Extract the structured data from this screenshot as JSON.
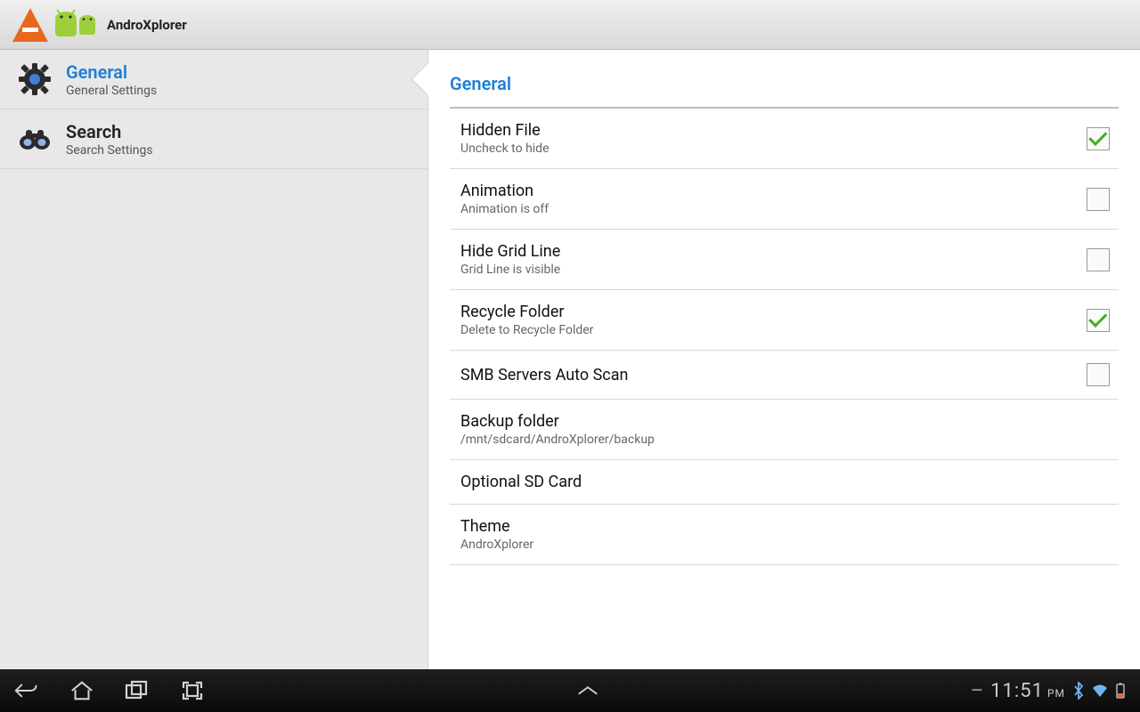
{
  "app": {
    "title": "AndroXplorer"
  },
  "sidebar": {
    "items": [
      {
        "title": "General",
        "subtitle": "General Settings",
        "icon": "gear-icon",
        "active": true
      },
      {
        "title": "Search",
        "subtitle": "Search Settings",
        "icon": "binoculars-icon",
        "active": false
      }
    ]
  },
  "content": {
    "heading": "General",
    "settings": [
      {
        "title": "Hidden File",
        "subtitle": "Uncheck to hide",
        "has_checkbox": true,
        "checked": true
      },
      {
        "title": "Animation",
        "subtitle": "Animation is off",
        "has_checkbox": true,
        "checked": false
      },
      {
        "title": "Hide Grid Line",
        "subtitle": "Grid Line is visible",
        "has_checkbox": true,
        "checked": false
      },
      {
        "title": "Recycle Folder",
        "subtitle": "Delete to Recycle Folder",
        "has_checkbox": true,
        "checked": true
      },
      {
        "title": "SMB Servers Auto Scan",
        "subtitle": "",
        "has_checkbox": true,
        "checked": false
      },
      {
        "title": "Backup folder",
        "subtitle": "/mnt/sdcard/AndroXplorer/backup",
        "has_checkbox": false
      },
      {
        "title": "Optional SD Card",
        "subtitle": "",
        "has_checkbox": false
      },
      {
        "title": "Theme",
        "subtitle": "AndroXplorer",
        "has_checkbox": false
      }
    ]
  },
  "navbar": {
    "time": "11:51",
    "ampm": "PM"
  }
}
